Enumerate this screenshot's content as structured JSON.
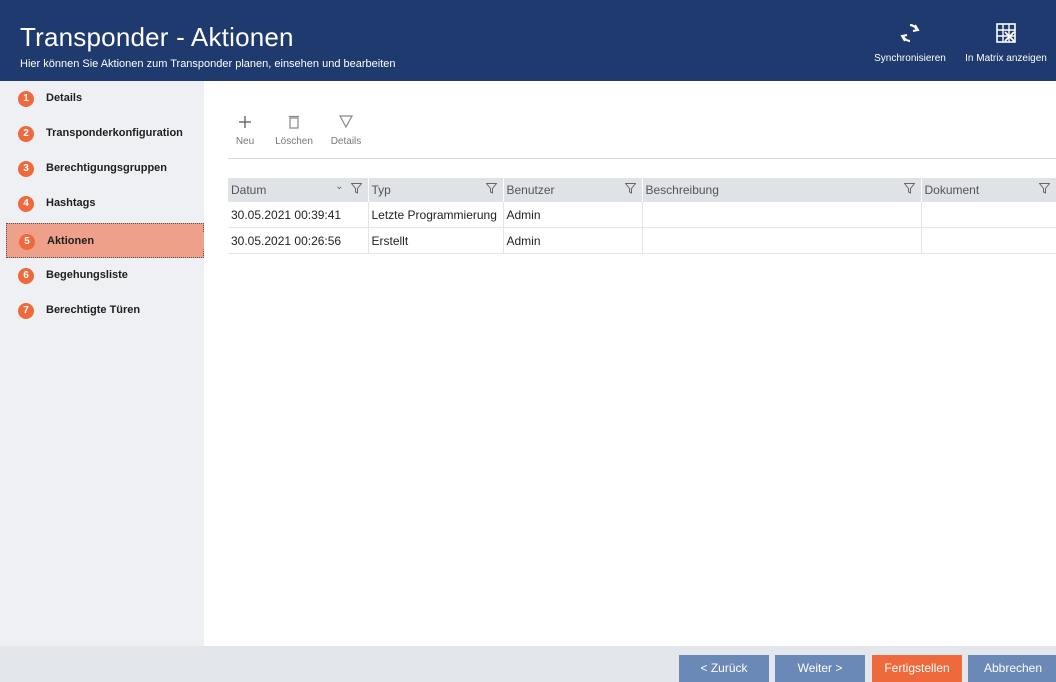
{
  "header": {
    "title": "Transponder - Aktionen",
    "subtitle": "Hier können Sie Aktionen zum Transponder planen, einsehen und bearbeiten",
    "sync_label": "Synchronisieren",
    "matrix_label": "In Matrix anzeigen"
  },
  "sidebar": {
    "items": [
      {
        "num": "1",
        "label": "Details"
      },
      {
        "num": "2",
        "label": "Transponderkonfiguration"
      },
      {
        "num": "3",
        "label": "Berechtigungsgruppen"
      },
      {
        "num": "4",
        "label": "Hashtags"
      },
      {
        "num": "5",
        "label": "Aktionen"
      },
      {
        "num": "6",
        "label": "Begehungsliste"
      },
      {
        "num": "7",
        "label": "Berechtigte Türen"
      }
    ],
    "active_index": 4
  },
  "toolbar": {
    "new_label": "Neu",
    "delete_label": "Löschen",
    "details_label": "Details"
  },
  "table": {
    "columns": [
      "Datum",
      "Typ",
      "Benutzer",
      "Beschreibung",
      "Dokument"
    ],
    "rows": [
      [
        "30.05.2021 00:39:41",
        "Letzte Programmierung",
        "Admin",
        "",
        ""
      ],
      [
        "30.05.2021 00:26:56",
        "Erstellt",
        "Admin",
        "",
        ""
      ]
    ]
  },
  "footer": {
    "back_label": "< Zurück",
    "next_label": "Weiter >",
    "finish_label": "Fertigstellen",
    "cancel_label": "Abbrechen"
  },
  "colors": {
    "header_bg": "#1f3a6e",
    "accent_orange": "#ee6a3c",
    "active_step_bg": "#eea08a",
    "footer_button": "#6a89b7"
  }
}
